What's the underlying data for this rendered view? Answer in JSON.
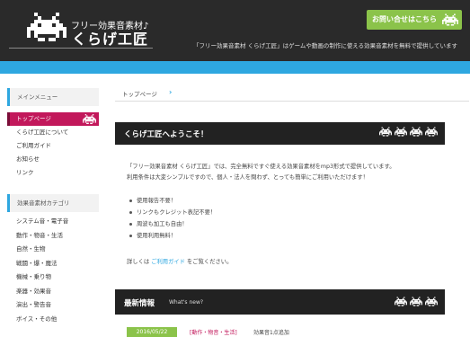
{
  "header": {
    "site_sub": "フリー効果音素材♪",
    "site_name": "くらげ工匠",
    "contact_label": "お問い合せはこちら",
    "tagline": "「フリー効果音素材 くらげ工匠」はゲームや動画の制作に使える効果音素材を無料で提供しています"
  },
  "sidebar": {
    "menu_heading": "メインメニュー",
    "menu_items": [
      {
        "label": "トップページ"
      },
      {
        "label": "くらげ工匠について"
      },
      {
        "label": "ご利用ガイド"
      },
      {
        "label": "お知らせ"
      },
      {
        "label": "リンク"
      }
    ],
    "category_heading": "効果音素材カテゴリ",
    "category_items": [
      {
        "label": "システム音・電子音"
      },
      {
        "label": "動作・物音・生活"
      },
      {
        "label": "自然・生物"
      },
      {
        "label": "戦闘・爆・魔法"
      },
      {
        "label": "機械・乗り物"
      },
      {
        "label": "楽器・効果音"
      },
      {
        "label": "演出・警告音"
      },
      {
        "label": "ボイス・その他"
      }
    ]
  },
  "main": {
    "breadcrumb": "トップページ",
    "welcome_title": "くらげ工匠へようこそ！",
    "intro_lines": [
      "「フリー効果音素材 くらげ工匠」では、完全無料ですぐ使える効果音素材をmp3形式で提供しています。",
      "利用条件は大変シンプルですので、個人・法人を問わず、とっても簡単にご利用いただけます！"
    ],
    "features": [
      "使用報告不要！",
      "リンクもクレジット表記不要！",
      "周波も加工も自由！",
      "使用利用無料！"
    ],
    "details_prefix": "詳しくは",
    "details_link": "ご利用ガイド",
    "details_suffix": "をご覧ください。",
    "news_title": "最新情報",
    "news_sub": "What's new?",
    "news": [
      {
        "date": "2016/05/22",
        "category": "[動作・物音・生活]",
        "text": "効果音1点追加"
      }
    ]
  },
  "colors": {
    "header_bg": "#2a2a2a",
    "accent_blue": "#2ea7e0",
    "accent_green": "#8bc34a",
    "active_magenta": "#c2185b"
  },
  "icons": {
    "logo": "space-invader-icon",
    "contact": "space-invader-icon",
    "breadcrumb": "chevron-right-icon"
  }
}
